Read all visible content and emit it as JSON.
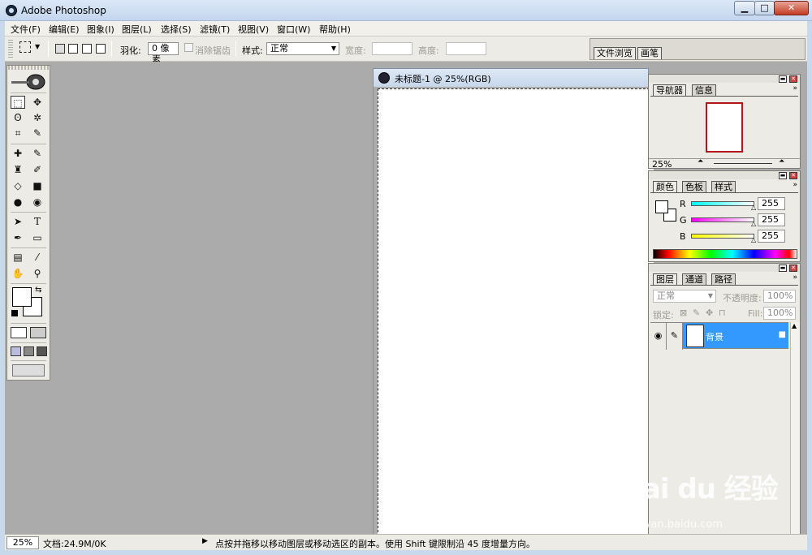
{
  "window": {
    "title": "Adobe Photoshop",
    "min": "▁",
    "max": "□",
    "close": "✕"
  },
  "menu": [
    "文件(F)",
    "编辑(E)",
    "图象(I)",
    "图层(L)",
    "选择(S)",
    "滤镜(T)",
    "视图(V)",
    "窗口(W)",
    "帮助(H)"
  ],
  "options": {
    "feather_label": "羽化:",
    "feather_value": "0 像素",
    "antialias_label": "消除锯齿",
    "style_label": "样式:",
    "style_value": "正常",
    "width_label": "宽度:",
    "height_label": "高度:",
    "well_tabs": [
      "文件浏览",
      "画笔"
    ]
  },
  "document": {
    "title": "未标题-1 @ 25%(RGB)"
  },
  "navigator": {
    "tabs": [
      "导航器",
      "信息"
    ],
    "zoom": "25%"
  },
  "color": {
    "tabs": [
      "颜色",
      "色板",
      "样式"
    ],
    "channels": [
      {
        "label": "R",
        "value": "255",
        "gradient": [
          "#00ffff",
          "#ffffff"
        ]
      },
      {
        "label": "G",
        "value": "255",
        "gradient": [
          "#ff00ff",
          "#ffffff"
        ]
      },
      {
        "label": "B",
        "value": "255",
        "gradient": [
          "#ffff00",
          "#ffffff"
        ]
      }
    ]
  },
  "layers": {
    "tabs": [
      "图层",
      "通道",
      "路径"
    ],
    "blend_mode": "正常",
    "opacity_label": "不透明度:",
    "opacity_value": "100%",
    "lock_label": "锁定:",
    "fill_label": "Fill:",
    "fill_value": "100%",
    "layer_name": "背景",
    "selected_color": "#3399ff"
  },
  "status": {
    "zoom": "25%",
    "doc_info": "文档:24.9M/0K",
    "message": "点按并拖移以移动图层或移动选区的副本。使用 Shift 键限制沿 45 度增量方向。"
  },
  "watermark": {
    "brand": "Bai du 经验",
    "url": "jingyan.baidu.com"
  },
  "icons": {
    "marquee": "⬚",
    "move": "✥",
    "lasso": "ʘ",
    "wand": "✲",
    "crop": "⌗",
    "slice": "✎",
    "heal": "✚",
    "brush": "✎",
    "stamp": "♜",
    "history": "✐",
    "eraser": "◇",
    "gradient": "■",
    "blur": "●",
    "dodge": "◉",
    "path-select": "➤",
    "type": "T",
    "pen": "✒",
    "shape": "▭",
    "notes": "▤",
    "eyedropper": "⁄",
    "hand": "✋",
    "zoom": "⚲"
  }
}
